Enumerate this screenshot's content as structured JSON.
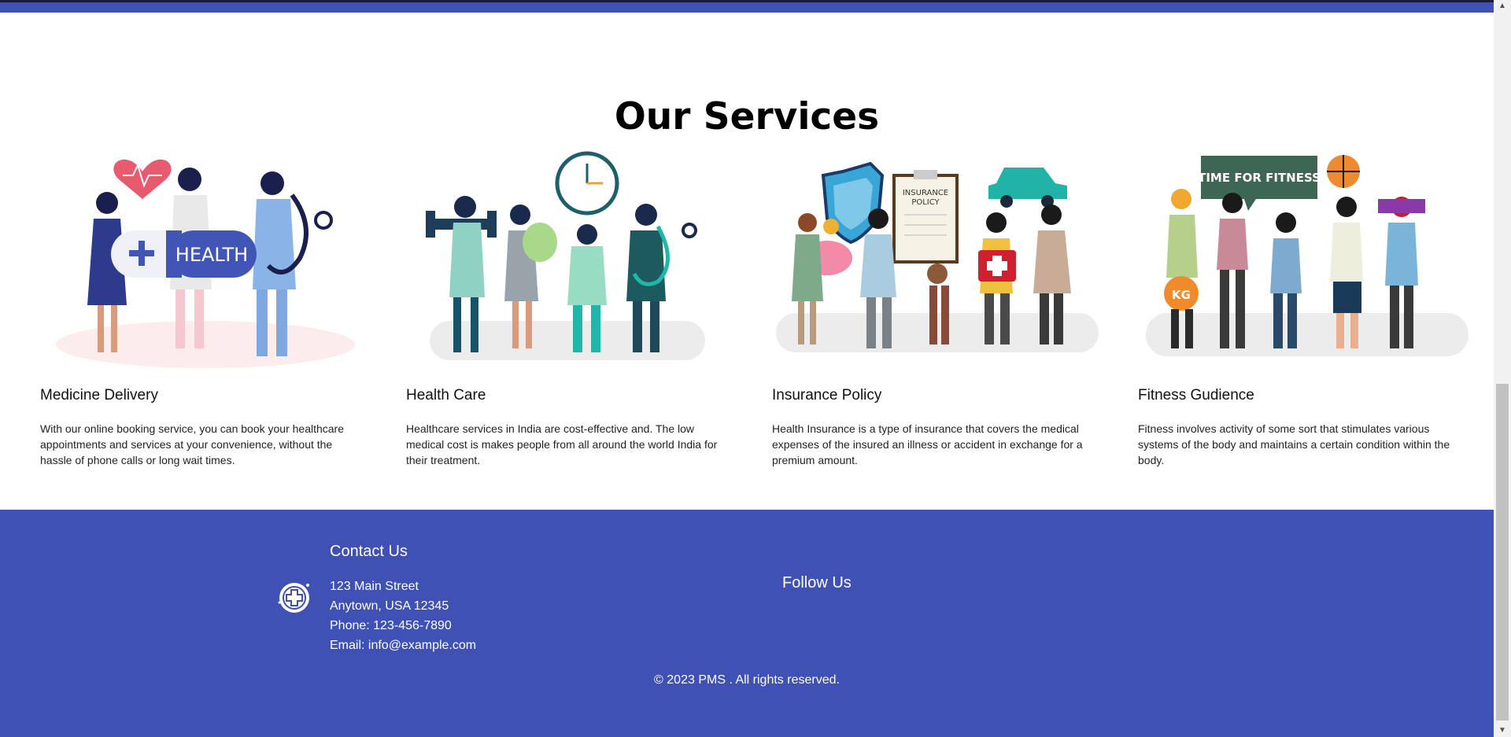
{
  "section": {
    "title": "Our Services"
  },
  "services": [
    {
      "title": "Medicine Delivery",
      "description": "With our online booking service, you can book your healthcare appointments and services at your convenience, without the hassle of phone calls or long wait times.",
      "badge": "HEALTH"
    },
    {
      "title": "Health Care",
      "description": "Healthcare services in India are cost-effective and. The low medical cost is makes people from all around the world India for their treatment."
    },
    {
      "title": "Insurance Policy",
      "description": "Health Insurance is a type of insurance that covers the medical expenses of the insured an illness or accident in exchange for a premium amount.",
      "badge_line1": "INSURANCE",
      "badge_line2": "POLICY"
    },
    {
      "title": "Fitness Gudience",
      "description": "Fitness involves activity of some sort that stimulates various systems of the body and maintains a certain condition within the body.",
      "badge": "TIME FOR FITNESS",
      "weight_label": "KG"
    }
  ],
  "footer": {
    "contact_title": "Contact Us",
    "address_line1": "123 Main Street",
    "address_line2": "Anytown, USA 12345",
    "phone": "Phone: 123-456-7890",
    "email": "Email: info@example.com",
    "follow_title": "Follow Us",
    "copyright": "© 2023 PMS . All rights reserved."
  },
  "colors": {
    "primary": "#3f51b5",
    "background": "#ffffff"
  }
}
